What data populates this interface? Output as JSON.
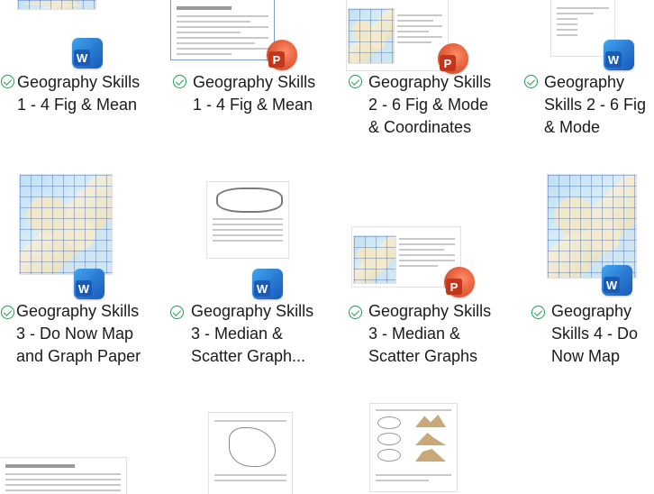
{
  "files": [
    {
      "name": "Geography Skills 1 - 4 Fig & Mean",
      "app": "Word",
      "app_icon": "word-icon",
      "status": "check-circle-icon"
    },
    {
      "name": "Geography Skills 1 - 4 Fig & Mean",
      "app": "PowerPoint",
      "app_icon": "powerpoint-icon",
      "status": "check-circle-icon"
    },
    {
      "name": "Geography Skills 2 - 6 Fig & Mode & Coordinates",
      "app": "PowerPoint",
      "app_icon": "powerpoint-icon",
      "status": "check-circle-icon"
    },
    {
      "name": "Geography Skills 2 - 6 Fig & Mode",
      "app": "Word",
      "app_icon": "word-icon",
      "status": "check-circle-icon"
    },
    {
      "name": "Geography Skills 3 - Do Now Map and Graph Paper",
      "app": "Word",
      "app_icon": "word-icon",
      "status": "check-circle-icon"
    },
    {
      "name": "Geography Skills 3 - Median & Scatter Graph...",
      "app": "Word",
      "app_icon": "word-icon",
      "status": "check-circle-icon"
    },
    {
      "name": "Geography Skills 3 - Median & Scatter Graphs",
      "app": "PowerPoint",
      "app_icon": "powerpoint-icon",
      "status": "check-circle-icon"
    },
    {
      "name": "Geography Skills 4 - Do Now Map",
      "app": "Word",
      "app_icon": "word-icon",
      "status": "check-circle-icon"
    }
  ],
  "app_letters": {
    "Word": "W",
    "PowerPoint": "P"
  },
  "colors": {
    "word": "#185abd",
    "powerpoint": "#c43e1c",
    "synced": "#16a34a"
  }
}
